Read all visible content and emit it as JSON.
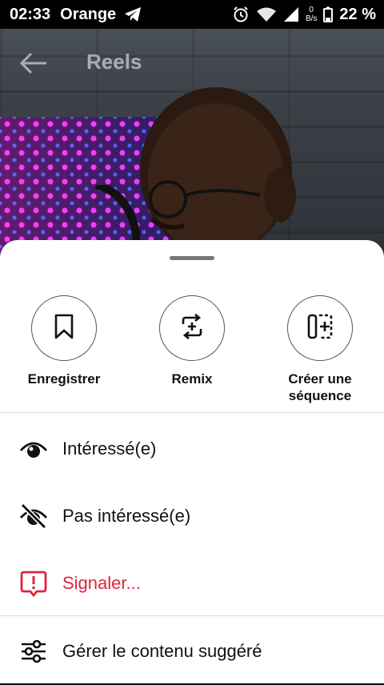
{
  "status_bar": {
    "time": "02:33",
    "carrier": "Orange",
    "net_speed_value": "0",
    "net_speed_unit": "B/s",
    "battery": "22 %"
  },
  "header": {
    "title": "Reels"
  },
  "actions": [
    {
      "label": "Enregistrer",
      "icon": "bookmark-icon"
    },
    {
      "label": "Remix",
      "icon": "remix-icon"
    },
    {
      "label_line1": "Créer une",
      "label_line2": "séquence",
      "icon": "sequence-icon"
    }
  ],
  "menu": [
    {
      "label": "Intéressé(e)",
      "icon": "eye-icon"
    },
    {
      "label": "Pas intéressé(e)",
      "icon": "eye-off-icon"
    },
    {
      "label": "Signaler...",
      "icon": "report-icon"
    },
    {
      "label": "Gérer le contenu suggéré",
      "icon": "sliders-icon"
    }
  ],
  "colors": {
    "danger": "#e0243a"
  }
}
